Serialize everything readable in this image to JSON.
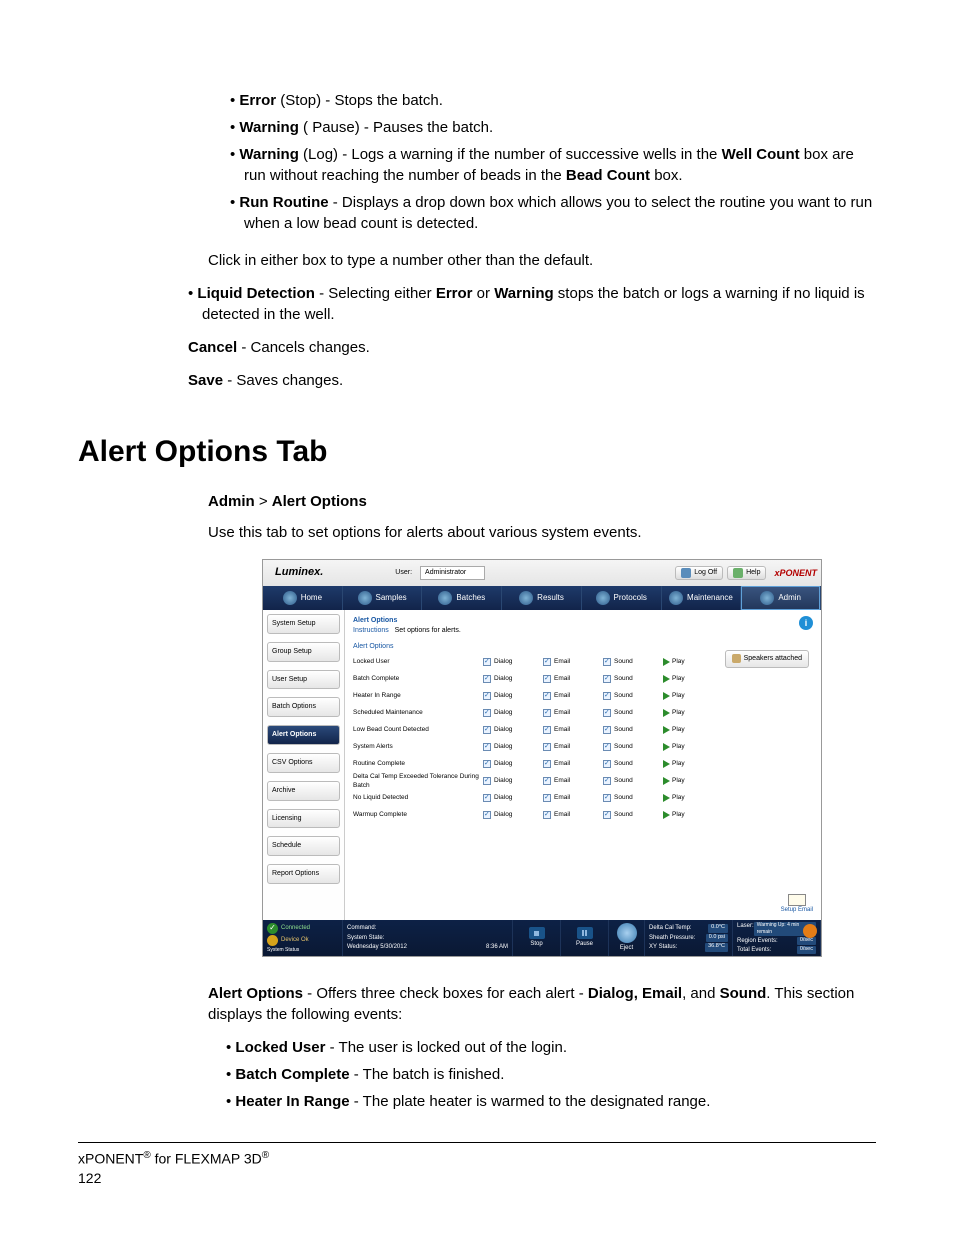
{
  "top_bullets": {
    "error": {
      "bold": "Error",
      "suffix": " (Stop) - Stops the batch."
    },
    "warn_pause": {
      "bold": "Warning",
      "suffix": " ( Pause) - Pauses the batch."
    },
    "warn_log_pre": "Warning",
    "warn_log_mid1": " (Log) - Logs a warning if the number of successive wells in the ",
    "warn_log_b2": "Well Count",
    "warn_log_mid2": " box are run without reaching the number of beads in the ",
    "warn_log_b3": "Bead Count",
    "warn_log_end": " box.",
    "run_routine_b": "Run Routine",
    "run_routine_t": " - Displays a drop down box which allows you to select the routine you want to run when a low bead count is detected."
  },
  "click_either": "Click in either box to type a number other than the default.",
  "liquid": {
    "b1": "Liquid Detection",
    "t1": " - Selecting either ",
    "b2": "Error",
    "t2": " or ",
    "b3": "Warning",
    "t3": " stops the batch or logs a warning if no liquid is detected in the well."
  },
  "cancel": {
    "b": "Cancel",
    "t": " - Cancels changes."
  },
  "save": {
    "b": "Save",
    "t": " - Saves changes."
  },
  "heading": "Alert Options Tab",
  "breadcrumb": {
    "a": "Admin",
    "sep": " > ",
    "b": "Alert Options"
  },
  "use_tab": "Use this tab to set options for alerts about various system events.",
  "screenshot": {
    "logo": "Luminex.",
    "user_lbl": "User:",
    "user_val": "Administrator",
    "logoff": "Log Off",
    "help": "Help",
    "brand": "xPONENT",
    "nav": [
      "Home",
      "Samples",
      "Batches",
      "Results",
      "Protocols",
      "Maintenance",
      "Admin"
    ],
    "nav_active": 6,
    "side": [
      "System Setup",
      "Group Setup",
      "User Setup",
      "Batch Options",
      "Alert Options",
      "CSV Options",
      "Archive",
      "Licensing",
      "Schedule",
      "Report Options"
    ],
    "side_active": 4,
    "hdr_title": "Alert Options",
    "hdr_sub1": "Instructions",
    "hdr_sub2": "Set options for alerts.",
    "fieldset": "Alert Options",
    "cols": [
      "Dialog",
      "Email",
      "Sound",
      "Play"
    ],
    "rows": [
      "Locked User",
      "Batch Complete",
      "Heater In Range",
      "Scheduled Maintenance",
      "Low Bead Count Detected",
      "System Alerts",
      "Routine Complete",
      "Delta Cal Temp Exceeded Tolerance During Batch",
      "No Liquid Detected",
      "Warmup Complete"
    ],
    "speakers": "Speakers attached",
    "setup_email": "Setup Email",
    "status": {
      "connected": "Connected",
      "device": "Device Ok",
      "sysstatus": "System Status",
      "command": "Command:",
      "sysstate": "System State:",
      "date": "Wednesday 5/30/2012",
      "time": "8:36 AM",
      "stop": "Stop",
      "pause": "Pause",
      "eject": "Eject",
      "grid": [
        {
          "l": "Delta Cal Temp:",
          "v": "0.0°C"
        },
        {
          "l": "Sheath Pressure:",
          "v": "0.0 psi"
        },
        {
          "l": "XY Status:",
          "v": "36.8°C"
        }
      ],
      "grid2": [
        {
          "l": "Laser:",
          "v": "Warming Up: 4 min remain"
        },
        {
          "l": "Region Events:",
          "v": "0/sec"
        },
        {
          "l": "Total Events:",
          "v": "0/sec"
        }
      ],
      "warmup": "WarmUp"
    }
  },
  "alert_options_desc": {
    "b1": "Alert Options",
    "t1": " - Offers three check boxes for each alert - ",
    "b2": "Dialog, Email",
    "t2": ", and ",
    "b3": "Sound",
    "t3": ". This section displays the following events:"
  },
  "events": [
    {
      "b": "Locked User",
      "t": " - The user is locked out of the login."
    },
    {
      "b": "Batch Complete",
      "t": " - The batch is finished."
    },
    {
      "b": "Heater In Range",
      "t": " - The plate heater is warmed to the designated range."
    }
  ],
  "footer": {
    "l1a": "xPONENT",
    "l1b": " for FLEXMAP 3D",
    "page": "122"
  }
}
